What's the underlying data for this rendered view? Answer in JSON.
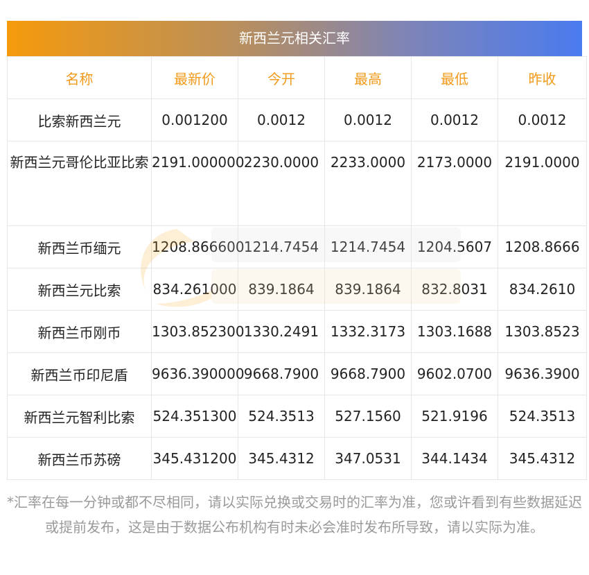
{
  "title": "新西兰元相关汇率",
  "columns": [
    "名称",
    "最新价",
    "今开",
    "最高",
    "最低",
    "昨收"
  ],
  "rows": [
    {
      "name": "比索新西兰元",
      "latest": "0.001200",
      "open": "0.0012",
      "high": "0.0012",
      "low": "0.0012",
      "prev": "0.0012"
    },
    {
      "name": "新西兰元哥伦比亚比索",
      "latest": "2191.000000",
      "open": "2230.0000",
      "high": "2233.0000",
      "low": "2173.0000",
      "prev": "2191.0000"
    },
    {
      "name": "新西兰币缅元",
      "latest": "1208.866600",
      "open": "1214.7454",
      "high": "1214.7454",
      "low": "1204.5607",
      "prev": "1208.8666"
    },
    {
      "name": "新西兰元比索",
      "latest": "834.261000",
      "open": "839.1864",
      "high": "839.1864",
      "low": "832.8031",
      "prev": "834.2610"
    },
    {
      "name": "新西兰币刚币",
      "latest": "1303.852300",
      "open": "1330.2491",
      "high": "1332.3173",
      "low": "1303.1688",
      "prev": "1303.8523"
    },
    {
      "name": "新西兰币印尼盾",
      "latest": "9636.390000",
      "open": "9668.7900",
      "high": "9668.7900",
      "low": "9602.0700",
      "prev": "9636.3900"
    },
    {
      "name": "新西兰元智利比索",
      "latest": "524.351300",
      "open": "524.3513",
      "high": "527.1560",
      "low": "521.9196",
      "prev": "524.3513"
    },
    {
      "name": "新西兰币苏磅",
      "latest": "345.431200",
      "open": "345.4312",
      "high": "347.0531",
      "low": "344.1434",
      "prev": "345.4312"
    }
  ],
  "note": "*汇率在每一分钟或都不尽相同，请以实际兑换或交易时的汇率为准，您或许看到有些数据延迟或提前发布，这是由于数据公布机构有时未必会准时发布所导致，请以实际为准。",
  "colors": {
    "header_start": "#f59a0c",
    "header_end": "#4a7bef",
    "column_header_text": "#f29a1a",
    "note_text": "#9a9a9a"
  }
}
